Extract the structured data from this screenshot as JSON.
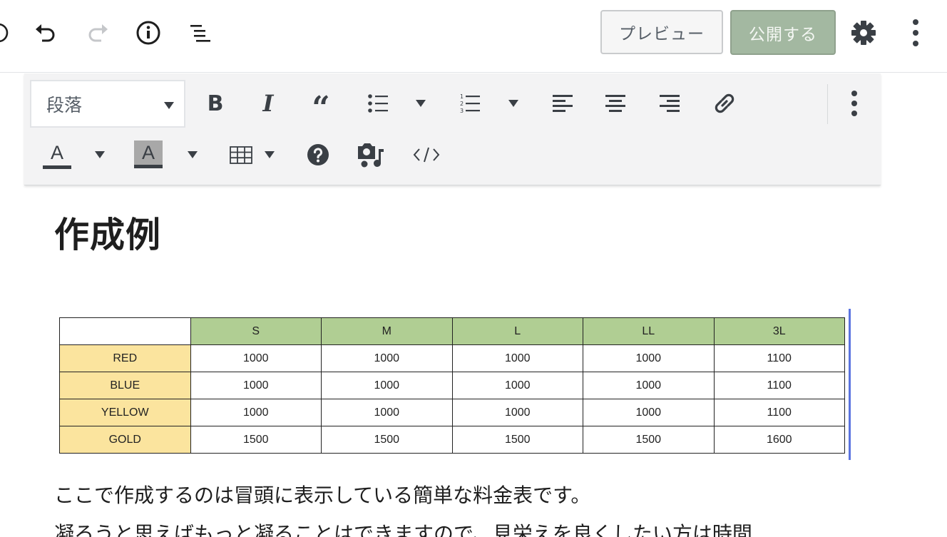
{
  "header": {
    "preview_label": "プレビュー",
    "publish_label": "公開する"
  },
  "toolbar": {
    "format_select_value": "段落"
  },
  "content": {
    "heading": "作成例",
    "table": {
      "columns": [
        "",
        "S",
        "M",
        "L",
        "LL",
        "3L"
      ],
      "rows": [
        {
          "label": "RED",
          "values": [
            "1000",
            "1000",
            "1000",
            "1000",
            "1100"
          ]
        },
        {
          "label": "BLUE",
          "values": [
            "1000",
            "1000",
            "1000",
            "1000",
            "1100"
          ]
        },
        {
          "label": "YELLOW",
          "values": [
            "1000",
            "1000",
            "1000",
            "1000",
            "1100"
          ]
        },
        {
          "label": "GOLD",
          "values": [
            "1500",
            "1500",
            "1500",
            "1500",
            "1600"
          ]
        }
      ]
    },
    "paragraph_1": "ここで作成するのは冒頭に表示している簡単な料金表です。",
    "paragraph_2": "凝ろうと思えばもっと凝ることはできますので、見栄えを良くしたい方は時間"
  },
  "colors": {
    "header_fill": "#b0ce93",
    "row_label_fill": "#fbe49e",
    "publish_button": "#a3b8a1",
    "focus_bar": "#5b74e0"
  },
  "icons": {
    "header": [
      "add-block-icon",
      "undo-icon",
      "redo-icon",
      "info-icon",
      "outline-icon",
      "gear-icon",
      "more-vertical-icon"
    ],
    "toolbar": [
      "bold-icon",
      "italic-icon",
      "quote-icon",
      "bullet-list-icon",
      "numbered-list-icon",
      "align-left-icon",
      "align-center-icon",
      "align-right-icon",
      "link-icon",
      "more-vertical-icon",
      "text-color-icon",
      "highlight-color-icon",
      "table-icon",
      "help-icon",
      "media-icon",
      "code-icon"
    ]
  }
}
